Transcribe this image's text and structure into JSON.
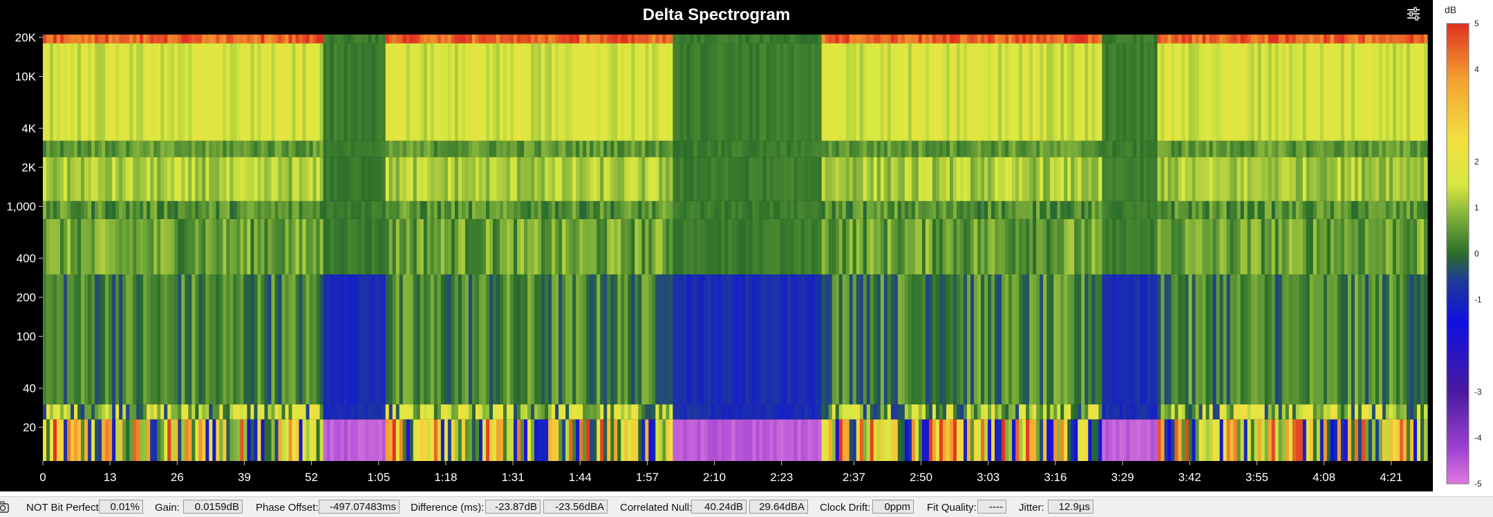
{
  "chart_data": {
    "type": "heatmap",
    "title": "Delta Spectrogram",
    "xlabel": "",
    "ylabel": "",
    "x_unit": "time (m:ss)",
    "xlim_seconds": [
      0,
      268
    ],
    "x_ticks": [
      {
        "value": 0,
        "label": "0"
      },
      {
        "value": 13,
        "label": "13"
      },
      {
        "value": 26,
        "label": "26"
      },
      {
        "value": 39,
        "label": "39"
      },
      {
        "value": 52,
        "label": "52"
      },
      {
        "value": 65,
        "label": "1:05"
      },
      {
        "value": 78,
        "label": "1:18"
      },
      {
        "value": 91,
        "label": "1:31"
      },
      {
        "value": 104,
        "label": "1:44"
      },
      {
        "value": 117,
        "label": "1:57"
      },
      {
        "value": 130,
        "label": "2:10"
      },
      {
        "value": 143,
        "label": "2:23"
      },
      {
        "value": 157,
        "label": "2:37"
      },
      {
        "value": 170,
        "label": "2:50"
      },
      {
        "value": 183,
        "label": "3:03"
      },
      {
        "value": 196,
        "label": "3:16"
      },
      {
        "value": 209,
        "label": "3:29"
      },
      {
        "value": 222,
        "label": "3:42"
      },
      {
        "value": 235,
        "label": "3:55"
      },
      {
        "value": 248,
        "label": "4:08"
      },
      {
        "value": 261,
        "label": "4:21"
      }
    ],
    "y_scale": "log",
    "ylim_hz": [
      11,
      21000
    ],
    "y_ticks": [
      {
        "value": 20,
        "label": "20"
      },
      {
        "value": 40,
        "label": "40"
      },
      {
        "value": 100,
        "label": "100"
      },
      {
        "value": 200,
        "label": "200"
      },
      {
        "value": 400,
        "label": "400"
      },
      {
        "value": 1000,
        "label": "1,000"
      },
      {
        "value": 2000,
        "label": "2K"
      },
      {
        "value": 4000,
        "label": "4K"
      },
      {
        "value": 10000,
        "label": "10K"
      },
      {
        "value": 20000,
        "label": "20K"
      }
    ],
    "colorbar": {
      "title": "dB",
      "range": [
        -5,
        5
      ],
      "tick_labels": [
        "5",
        "4",
        "2",
        "1",
        "0",
        "-1",
        "-3",
        "-4",
        "-5"
      ],
      "tick_values": [
        5,
        4,
        2,
        1,
        0,
        -1,
        -3,
        -4,
        -5
      ],
      "stops": [
        {
          "value": -5,
          "color": "#e07ae0"
        },
        {
          "value": -4.2,
          "color": "#9b3fd0"
        },
        {
          "value": -3,
          "color": "#4a1aa0"
        },
        {
          "value": -1.5,
          "color": "#1010e0"
        },
        {
          "value": -0.6,
          "color": "#1f3a9a"
        },
        {
          "value": 0,
          "color": "#2a6e2a"
        },
        {
          "value": 0.8,
          "color": "#7fb03a"
        },
        {
          "value": 1.5,
          "color": "#d8e840"
        },
        {
          "value": 2.5,
          "color": "#f2e040"
        },
        {
          "value": 3.8,
          "color": "#f4a030"
        },
        {
          "value": 5,
          "color": "#e03020"
        }
      ]
    },
    "quiet_segments_seconds": [
      [
        54,
        66
      ],
      [
        122,
        151
      ],
      [
        205,
        216
      ]
    ],
    "bands": [
      {
        "range_hz": [
          11,
          23
        ],
        "mean_db": 1.5,
        "spread_db": 3.5
      },
      {
        "range_hz": [
          23,
          30
        ],
        "mean_db": 1.0,
        "spread_db": 1.6
      },
      {
        "range_hz": [
          30,
          300
        ],
        "mean_db": 0.2,
        "spread_db": 0.7
      },
      {
        "range_hz": [
          300,
          800
        ],
        "mean_db": 0.6,
        "spread_db": 0.6
      },
      {
        "range_hz": [
          800,
          1100
        ],
        "mean_db": 0.4,
        "spread_db": 0.5
      },
      {
        "range_hz": [
          1100,
          2400
        ],
        "mean_db": 1.1,
        "spread_db": 0.45
      },
      {
        "range_hz": [
          2400,
          3200
        ],
        "mean_db": 0.5,
        "spread_db": 0.4
      },
      {
        "range_hz": [
          3200,
          18000
        ],
        "mean_db": 1.6,
        "spread_db": 0.5
      },
      {
        "range_hz": [
          18000,
          21000
        ],
        "mean_db": 4.5,
        "spread_db": 0.6
      }
    ]
  },
  "status": {
    "bit_perfect_label": "NOT Bit Perfect",
    "bit_perfect_value": "0.01%",
    "gain_label": "Gain:",
    "gain_value": "0.0159dB",
    "phase_label": "Phase Offset:",
    "phase_value": "-497.07483ms",
    "difference_label": "Difference (ms):",
    "difference_value1": "-23.87dB",
    "difference_value2": "-23.56dBA",
    "null_label": "Correlated Null:",
    "null_value1": "40.24dB",
    "null_value2": "29.64dBA",
    "drift_label": "Clock Drift:",
    "drift_value": "0ppm",
    "fit_label": "Fit Quality:",
    "fit_value": "----",
    "jitter_label": "Jitter:",
    "jitter_value": "12.9µs"
  },
  "icons": {
    "settings": "sliders-icon",
    "camera": "camera-icon"
  }
}
